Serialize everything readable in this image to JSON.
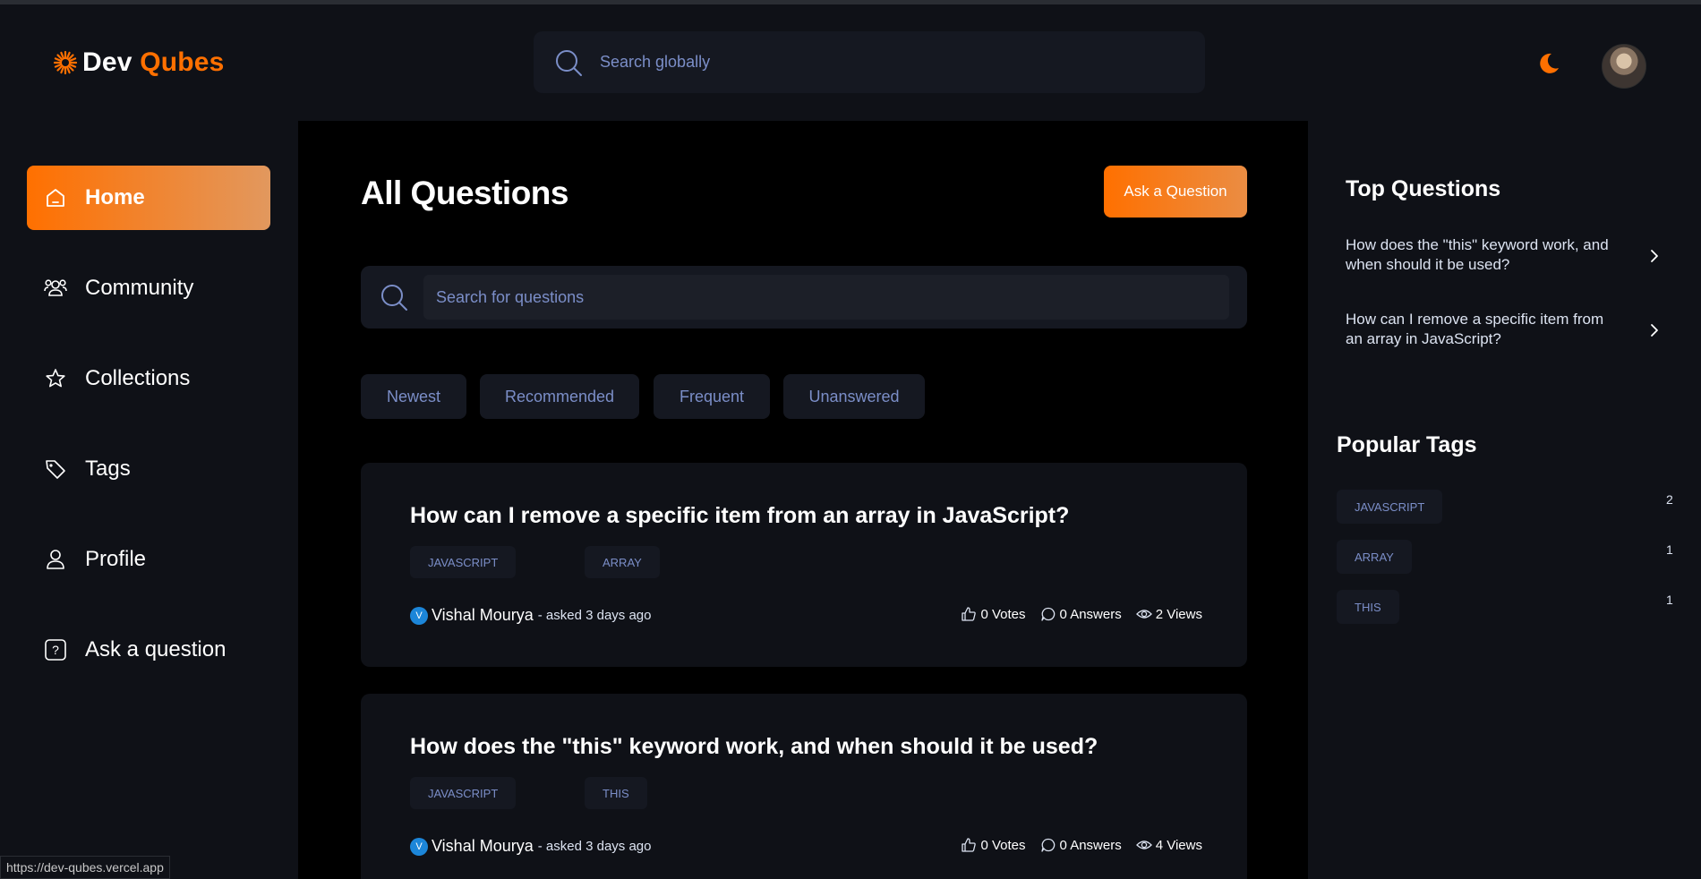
{
  "header": {
    "logo": {
      "word1": "Dev",
      "word2": "Qubes"
    },
    "search_placeholder": "Search globally"
  },
  "sidebar": {
    "items": [
      {
        "label": "Home",
        "icon": "home-icon",
        "active": true
      },
      {
        "label": "Community",
        "icon": "users-icon",
        "active": false
      },
      {
        "label": "Collections",
        "icon": "star-icon",
        "active": false
      },
      {
        "label": "Tags",
        "icon": "tag-icon",
        "active": false
      },
      {
        "label": "Profile",
        "icon": "user-icon",
        "active": false
      },
      {
        "label": "Ask a question",
        "icon": "question-icon",
        "active": false
      }
    ]
  },
  "main": {
    "title": "All Questions",
    "ask_button": "Ask a Question",
    "search_placeholder": "Search for questions",
    "filters": [
      "Newest",
      "Recommended",
      "Frequent",
      "Unanswered"
    ],
    "questions": [
      {
        "title": "How can I remove a specific item from an array in JavaScript?",
        "tags": [
          "JAVASCRIPT",
          "ARRAY"
        ],
        "author": "Vishal Mourya",
        "author_initial": "V",
        "asked": "- asked 3 days ago",
        "votes": "0 Votes",
        "answers": "0 Answers",
        "views": "2 Views"
      },
      {
        "title": "How does the \"this\" keyword work, and when should it be used?",
        "tags": [
          "JAVASCRIPT",
          "THIS"
        ],
        "author": "Vishal Mourya",
        "author_initial": "V",
        "asked": "- asked 3 days ago",
        "votes": "0 Votes",
        "answers": "0 Answers",
        "views": "4 Views"
      }
    ]
  },
  "rightbar": {
    "top_questions_title": "Top Questions",
    "top_questions": [
      "How does the \"this\" keyword work, and when should it be used?",
      "How can I remove a specific item from an array in JavaScript?"
    ],
    "popular_tags_title": "Popular Tags",
    "popular_tags": [
      {
        "name": "JAVASCRIPT",
        "count": "2"
      },
      {
        "name": "ARRAY",
        "count": "1"
      },
      {
        "name": "THIS",
        "count": "1"
      }
    ]
  },
  "status_bar": {
    "url": "https://dev-qubes.vercel.app"
  },
  "colors": {
    "accent": "#ff7000",
    "accent_light": "#e2985e",
    "muted_text": "#7b8ec8",
    "surface": "#151821",
    "background": "#0f1117"
  }
}
